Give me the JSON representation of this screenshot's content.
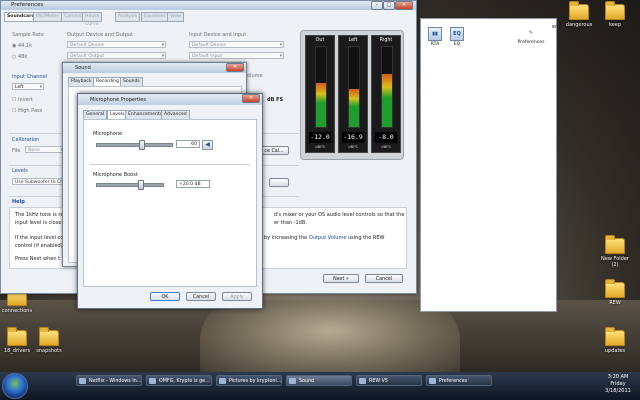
{
  "prefs": {
    "title": "Preferences",
    "tabs": [
      "Soundcard",
      "Mic/Meter",
      "Comms",
      "House Curve",
      "Analysis",
      "Equaliser",
      "View"
    ],
    "sample_rate_label": "Sample Rate",
    "sample_rates": [
      "44.1k",
      "48k"
    ],
    "output_label": "Output Device and Output",
    "output_device": "Default Device",
    "output_output": "Default Output",
    "input_label": "Input Device and Input",
    "input_device": "Default Device",
    "input_input": "Default Input",
    "input_channel_label": "Input Channel",
    "input_channel_value": "Left",
    "invert_label": "Invert",
    "highpass_label": "High Pass",
    "volume_label": "olume",
    "dbfs_label": "dB FS",
    "calibration_label": "Calibration",
    "file_label": "File",
    "file_value": "None",
    "cal_button": "ce Cal...",
    "levels_label": "Levels",
    "levels_value": "Use Subwoofer to Ch",
    "help_label": "Help",
    "help_line1": "The 1kHz tone is re",
    "help_line2": "input level is close t",
    "help_line3": "If the input level coul",
    "help_line4": "control (if enabled)",
    "help_line5": "Press Next when t",
    "help_line5_bold": "Next",
    "help_right1": "d's mixer or your OS audio level controls so that the",
    "help_right2": "er than -1dB.",
    "help_right3_a": "by increasing the ",
    "help_right3_link": "Output Volume",
    "help_right3_b": " using the REW",
    "next_button": "Next »",
    "cancel_button": "Cancel"
  },
  "meters": [
    {
      "name": "Out",
      "reading": "-12.0",
      "unit": "dBFS",
      "level": 0.55
    },
    {
      "name": "Left",
      "reading": "-16.9",
      "unit": "dBFS",
      "level": 0.48
    },
    {
      "name": "Right",
      "reading": "-8.0",
      "unit": "dBFS",
      "level": 0.66
    }
  ],
  "rew_toolbar": {
    "rta_label": "RTA",
    "eq_label": "EQ",
    "rta_glyph": "▮▮",
    "eq_glyph": "EQ",
    "preferences_label": "Preferences",
    "partial_label": "er"
  },
  "sound": {
    "title": "Sound",
    "tabs": [
      "Playback",
      "Recording",
      "Sounds"
    ]
  },
  "mic": {
    "title": "Microphone Properties",
    "tabs": [
      "General",
      "Levels",
      "Enhancements",
      "Advanced"
    ],
    "microphone_label": "Microphone",
    "microphone_value": "60",
    "microphone_level": 0.6,
    "boost_label": "Microphone Boost",
    "boost_value": "+20.0 dB",
    "boost_level": 0.67,
    "ok_button": "OK",
    "cancel_button": "Cancel",
    "apply_button": "Apply"
  },
  "desktop_icons": [
    {
      "label": "dangerous"
    },
    {
      "label": "keep"
    },
    {
      "label": "New Folder (2)"
    },
    {
      "label": "REW"
    },
    {
      "label": "updates"
    },
    {
      "label": "connections"
    },
    {
      "label": "18_drivers"
    },
    {
      "label": "snapshots"
    }
  ],
  "taskbar": {
    "tasks": [
      {
        "label": "Netflix - Windows In..."
      },
      {
        "label": "OMFG, Krypto is ge..."
      },
      {
        "label": "Pictures by kryptoni..."
      },
      {
        "label": "Sound"
      },
      {
        "label": "REW V5"
      },
      {
        "label": "Preferences"
      }
    ],
    "time": "3:20 AM",
    "day": "Friday",
    "date": "3/18/2011"
  },
  "colors": {
    "accent": "#1c4fa6",
    "meter_green": "#1f9e2f"
  }
}
